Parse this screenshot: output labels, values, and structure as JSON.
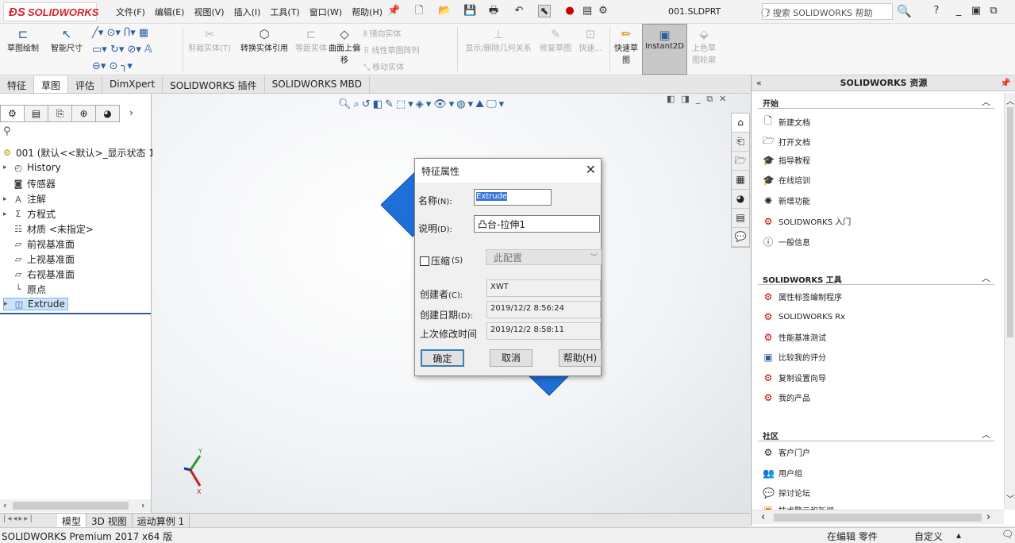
{
  "app": {
    "logo": "SOLIDWORKS",
    "filename": "001.SLDPRT",
    "help_search_placeholder": "搜索 SOLIDWORKS 帮助"
  },
  "menu": [
    "文件(F)",
    "编辑(E)",
    "视图(V)",
    "插入(I)",
    "工具(T)",
    "窗口(W)",
    "帮助(H)"
  ],
  "ribbon": {
    "sketch": "草图绘制",
    "smart_dim": "智能尺寸",
    "trim": "剪裁实体(T)",
    "convert": "转换实体引用",
    "offset": "等距实体",
    "surface_offset": "曲面上偏移",
    "mirror": "镜向实体",
    "linear_pattern": "线性草图阵列",
    "move": "移动实体",
    "relations": "显示/删除几何关系",
    "repair": "修复草图",
    "quick": "快速...",
    "rapid_sketch": "快速草图",
    "instant2d": "Instant2D",
    "shaded": "上色草图轮廓"
  },
  "tabs": [
    "特征",
    "草图",
    "评估",
    "DimXpert",
    "SOLIDWORKS 插件",
    "SOLIDWORKS MBD"
  ],
  "tree": {
    "root": "001 (默认<<默认>_显示状态 1",
    "items": [
      "History",
      "传感器",
      "注解",
      "方程式",
      "材质 <未指定>",
      "前视基准面",
      "上视基准面",
      "右视基准面",
      "原点",
      "Extrude"
    ]
  },
  "dialog": {
    "title": "特征属性",
    "name_label": "名称",
    "name_key": "(N):",
    "name_value": "Extrude",
    "desc_label": "说明",
    "desc_key": "(D):",
    "desc_value": "凸台-拉伸1",
    "suppress_label": "压缩",
    "suppress_key": "(S)",
    "config_value": "此配置",
    "creator_label": "创建者",
    "creator_key": "(C):",
    "creator_value": "XWT",
    "created_label": "创建日期",
    "created_key": "(D):",
    "created_value": "2019/12/2 8:56:24",
    "modified_label": "上次修改时间",
    "modified_value": "2019/12/2 8:58:11",
    "ok": "确定",
    "cancel": "取消",
    "help": "帮助(H)"
  },
  "panel": {
    "title": "SOLIDWORKS 资源",
    "start": {
      "head": "开始",
      "items": [
        "新建文档",
        "打开文档",
        "指导教程",
        "在线培训",
        "新增功能",
        "SOLIDWORKS 入门",
        "一般信息"
      ]
    },
    "tools": {
      "head": "SOLIDWORKS 工具",
      "items": [
        "属性标签编制程序",
        "SOLIDWORKS Rx",
        "性能基准测试",
        "比较我的评分",
        "复制设置向导",
        "我的产品"
      ]
    },
    "community": {
      "head": "社区",
      "items": [
        "客户门户",
        "用户组",
        "探讨论坛",
        "技术警示和新闻"
      ]
    }
  },
  "bottom_tabs": [
    "模型",
    "3D 视图",
    "运动算例 1"
  ],
  "status": {
    "left": "SOLIDWORKS Premium 2017 x64 版",
    "editing": "在编辑 零件",
    "custom": "自定义"
  }
}
